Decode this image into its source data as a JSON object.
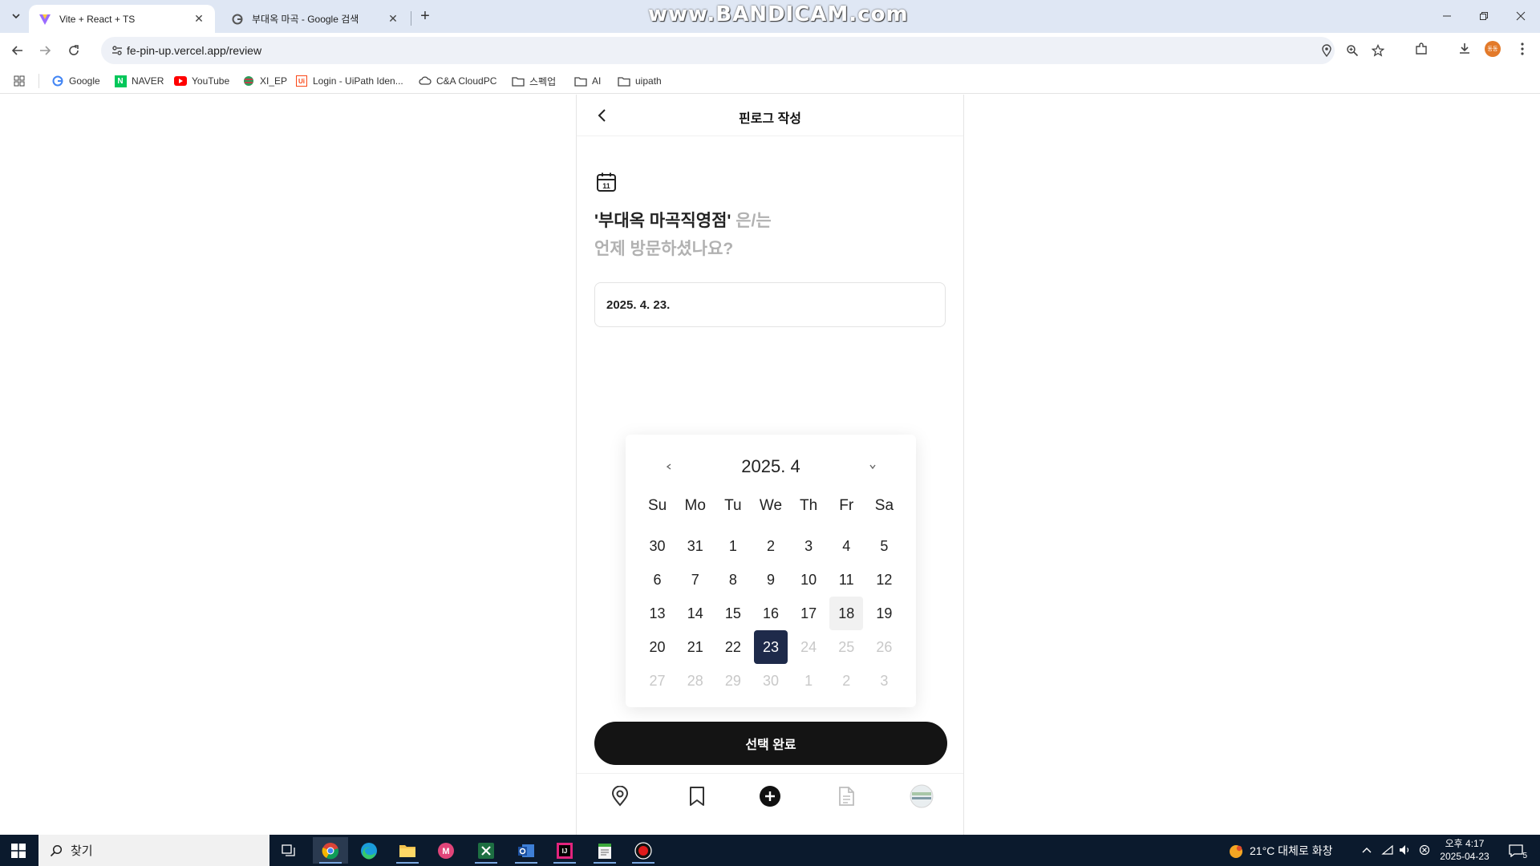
{
  "browser": {
    "tabs": [
      {
        "title": "Vite + React + TS",
        "active": true,
        "icon": "vite-icon"
      },
      {
        "title": "부대옥 마곡 - Google 검색",
        "active": false,
        "icon": "google-icon"
      }
    ],
    "watermark": "www.BANDICAM.com",
    "url": "fe-pin-up.vercel.app/review",
    "bookmarks": [
      {
        "label": "Google",
        "icon": "google-icon"
      },
      {
        "label": "NAVER",
        "icon": "naver-icon"
      },
      {
        "label": "YouTube",
        "icon": "youtube-icon"
      },
      {
        "label": "XI_EP",
        "icon": "xi-icon"
      },
      {
        "label": "Login - UiPath Iden...",
        "icon": "uipath-icon"
      },
      {
        "label": "C&A CloudPC",
        "icon": "cloud-icon"
      },
      {
        "label": "스펙업",
        "icon": "folder-icon"
      },
      {
        "label": "AI",
        "icon": "folder-icon"
      },
      {
        "label": "uipath",
        "icon": "folder-icon"
      }
    ],
    "profile_initial": "동동",
    "accent": "#dfe7f4"
  },
  "app": {
    "title": "핀로그 작성",
    "question_place": "'부대옥 마곡직영점'",
    "question_suffix": " 은/는",
    "question_line2": "언제 방문하셨나요?",
    "date_value": "2025. 4. 23.",
    "datepicker": {
      "title": "2025. 4",
      "weekdays": [
        "Su",
        "Mo",
        "Tu",
        "We",
        "Th",
        "Fr",
        "Sa"
      ],
      "days": [
        {
          "d": "30",
          "s": ""
        },
        {
          "d": "31",
          "s": ""
        },
        {
          "d": "1",
          "s": ""
        },
        {
          "d": "2",
          "s": ""
        },
        {
          "d": "3",
          "s": ""
        },
        {
          "d": "4",
          "s": ""
        },
        {
          "d": "5",
          "s": ""
        },
        {
          "d": "6",
          "s": ""
        },
        {
          "d": "7",
          "s": ""
        },
        {
          "d": "8",
          "s": ""
        },
        {
          "d": "9",
          "s": ""
        },
        {
          "d": "10",
          "s": ""
        },
        {
          "d": "11",
          "s": ""
        },
        {
          "d": "12",
          "s": ""
        },
        {
          "d": "13",
          "s": ""
        },
        {
          "d": "14",
          "s": ""
        },
        {
          "d": "15",
          "s": ""
        },
        {
          "d": "16",
          "s": ""
        },
        {
          "d": "17",
          "s": ""
        },
        {
          "d": "18",
          "s": "today"
        },
        {
          "d": "19",
          "s": ""
        },
        {
          "d": "20",
          "s": ""
        },
        {
          "d": "21",
          "s": ""
        },
        {
          "d": "22",
          "s": ""
        },
        {
          "d": "23",
          "s": "selected"
        },
        {
          "d": "24",
          "s": "muted"
        },
        {
          "d": "25",
          "s": "muted"
        },
        {
          "d": "26",
          "s": "muted"
        },
        {
          "d": "27",
          "s": "muted"
        },
        {
          "d": "28",
          "s": "muted"
        },
        {
          "d": "29",
          "s": "muted"
        },
        {
          "d": "30",
          "s": "muted"
        },
        {
          "d": "1",
          "s": "muted"
        },
        {
          "d": "2",
          "s": "muted"
        },
        {
          "d": "3",
          "s": "muted"
        }
      ],
      "selected_color": "#1e2a4a"
    },
    "confirm_label": "선택 완료",
    "bottom_nav": [
      "location-pin-icon",
      "bookmark-icon",
      "add-icon",
      "document-icon",
      "profile-icon"
    ]
  },
  "taskbar": {
    "search_label": "찾기",
    "weather": "21°C 대체로 화창",
    "time": "오후 4:17",
    "date": "2025-04-23",
    "notifications": "5"
  }
}
